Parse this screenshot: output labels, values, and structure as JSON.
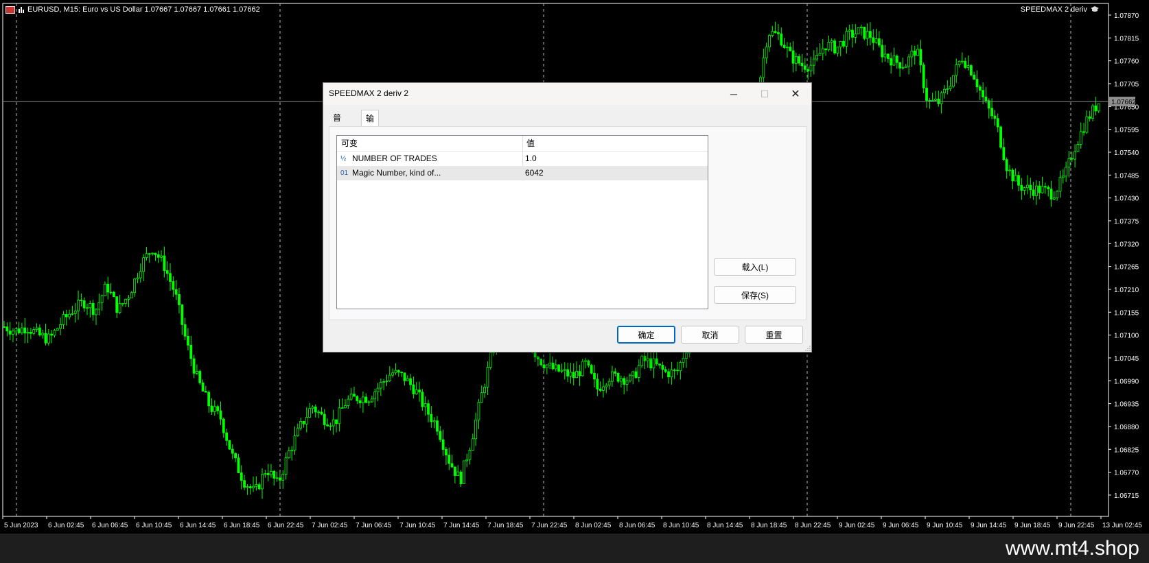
{
  "chart": {
    "title": "EURUSD, M15:  Euro vs US Dollar  1.07667 1.07667 1.07661 1.07662",
    "ea_name": "SPEEDMAX 2 deriv",
    "price_labels": [
      "1.07870",
      "1.07815",
      "1.07760",
      "1.07705",
      "1.07650",
      "1.07595",
      "1.07540",
      "1.07485",
      "1.07430",
      "1.07375",
      "1.07320",
      "1.07265",
      "1.07210",
      "1.07155",
      "1.07100",
      "1.07045",
      "1.06990",
      "1.06935",
      "1.06880",
      "1.06825",
      "1.06770",
      "1.06715"
    ],
    "current_price": "1.07662",
    "time_labels": [
      "5 Jun 2023",
      "6 Jun 02:45",
      "6 Jun 06:45",
      "6 Jun 10:45",
      "6 Jun 14:45",
      "6 Jun 18:45",
      "6 Jun 22:45",
      "7 Jun 02:45",
      "7 Jun 06:45",
      "7 Jun 10:45",
      "7 Jun 14:45",
      "7 Jun 18:45",
      "7 Jun 22:45",
      "8 Jun 02:45",
      "8 Jun 06:45",
      "8 Jun 10:45",
      "8 Jun 14:45",
      "8 Jun 18:45",
      "8 Jun 22:45",
      "9 Jun 02:45",
      "9 Jun 06:45",
      "9 Jun 10:45",
      "9 Jun 14:45",
      "9 Jun 18:45",
      "9 Jun 22:45",
      "13 Jun 02:45"
    ],
    "price_series": [
      1.0712,
      1.0711,
      1.0712,
      1.071,
      1.0709,
      1.0713,
      1.0716,
      1.0718,
      1.0716,
      1.0722,
      1.0716,
      1.072,
      1.0727,
      1.0731,
      1.0727,
      1.072,
      1.0708,
      1.0699,
      1.0693,
      1.069,
      1.0681,
      1.0675,
      1.0672,
      1.0678,
      1.0674,
      1.0682,
      1.0688,
      1.0693,
      1.069,
      1.0689,
      1.0694,
      1.0695,
      1.0695,
      1.0698,
      1.0701,
      1.07,
      1.0697,
      1.0692,
      1.0688,
      1.068,
      1.0675,
      1.0685,
      1.0697,
      1.0708,
      1.0712,
      1.0712,
      1.0708,
      1.0704,
      1.0702,
      1.0701,
      1.07,
      1.0703,
      1.0697,
      1.07,
      1.07,
      1.0699,
      1.0704,
      1.0703,
      1.0701,
      1.0701,
      1.0708,
      1.0712,
      1.0718,
      1.0728,
      1.0742,
      1.0757,
      1.0767,
      1.0783,
      1.0782,
      1.0777,
      1.0775,
      1.0775,
      1.078,
      1.0779,
      1.0782,
      1.0783,
      1.0782,
      1.0778,
      1.0776,
      1.0775,
      1.0779,
      1.0766,
      1.0766,
      1.0771,
      1.0777,
      1.0773,
      1.0766,
      1.0761,
      1.075,
      1.0746,
      1.0745,
      1.0745,
      1.0744,
      1.0748,
      1.0756,
      1.0762,
      1.0766
    ],
    "series_color": "#00ff00"
  },
  "dialog": {
    "title": "SPEEDMAX 2 deriv 2",
    "minimize_glyph": "─",
    "maximize_glyph": "☐",
    "close_glyph": "✕",
    "tabs": [
      {
        "label": "普通",
        "active": false
      },
      {
        "label": "输入",
        "active": true
      }
    ],
    "grid": {
      "col_variable": "可变",
      "col_value": "值",
      "rows": [
        {
          "type_icon": "½",
          "name": "NUMBER OF TRADES",
          "value": "1.0"
        },
        {
          "type_icon": "01",
          "name": "Magic Number, kind of...",
          "value": "6042"
        }
      ]
    },
    "load_button": "载入(L)",
    "save_button": "保存(S)",
    "ok_button": "确定",
    "cancel_button": "取消",
    "reset_button": "重置"
  },
  "footer": {
    "watermark": "www.mt4.shop"
  }
}
